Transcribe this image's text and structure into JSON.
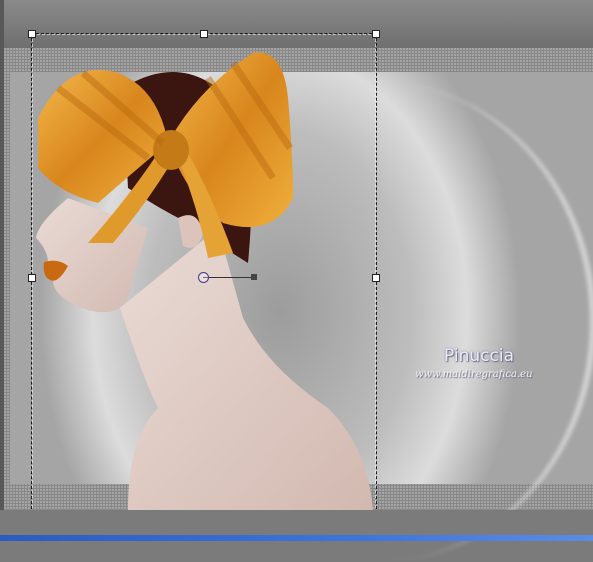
{
  "watermark": {
    "name": "Pinuccia",
    "url": "www.maidiregrafica.eu"
  },
  "canvas": {
    "background_color": "#7b7b7b",
    "taskbar_color": "#3e74db"
  },
  "selection": {
    "style": "dashed marquee with 8 resize handles and a rotation pivot"
  }
}
